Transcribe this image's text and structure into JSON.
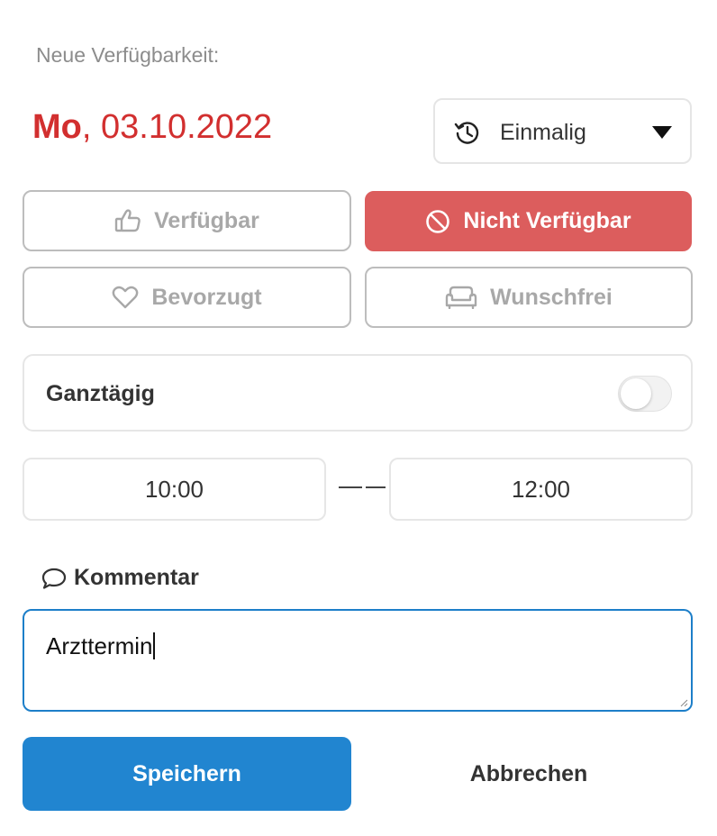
{
  "heading": "Neue Verfügbarkeit:",
  "date": {
    "weekday": "Mo",
    "separator": ",",
    "value": "03.10.2022"
  },
  "recurrence": {
    "icon": "history-icon",
    "selected": "Einmalig"
  },
  "options": [
    {
      "label": "Verfügbar",
      "icon": "thumbs-up-icon",
      "active": false
    },
    {
      "label": "Nicht Verfügbar",
      "icon": "ban-icon",
      "active": true
    },
    {
      "label": "Bevorzugt",
      "icon": "heart-icon",
      "active": false
    },
    {
      "label": "Wunschfrei",
      "icon": "couch-icon",
      "active": false
    }
  ],
  "all_day": {
    "label": "Ganztägig",
    "enabled": false
  },
  "time": {
    "from": "10:00",
    "to": "12:00"
  },
  "comment": {
    "label": "Kommentar",
    "icon": "comment-icon",
    "value": "Arzttermin"
  },
  "actions": {
    "save": "Speichern",
    "cancel": "Abbrechen"
  },
  "colors": {
    "date": "#d22f2f",
    "active_option": "#dc5d5d",
    "primary": "#2185d0"
  }
}
